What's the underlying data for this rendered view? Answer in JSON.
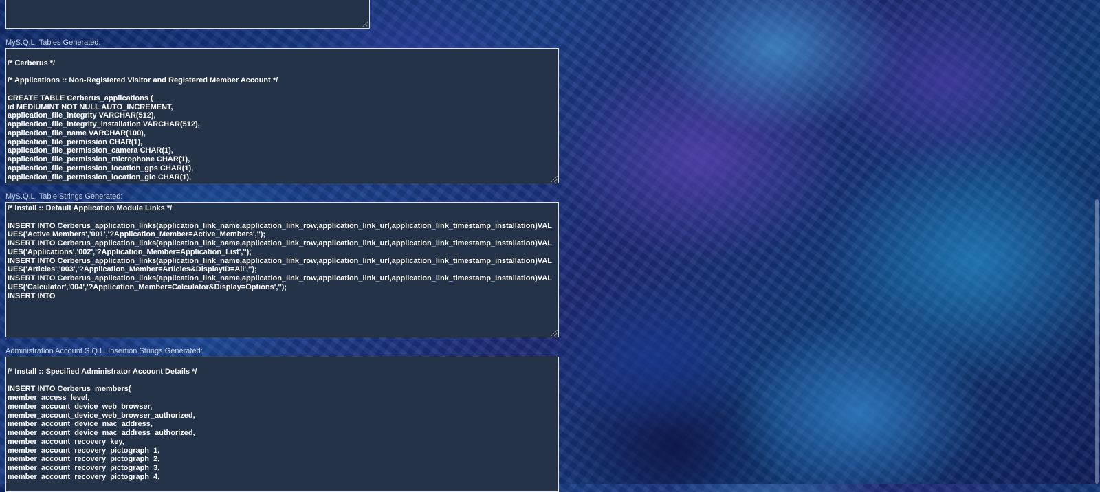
{
  "sections": [
    {
      "label": "",
      "content": ""
    },
    {
      "label": "MyS.Q.L. Tables Generated:",
      "content": "\n/* Cerberus */\n\n/* Applications :: Non-Registered Visitor and Registered Member Account */\n\nCREATE TABLE Cerberus_applications (\nid MEDIUMINT NOT NULL AUTO_INCREMENT,\napplication_file_integrity VARCHAR(512),\napplication_file_integrity_installation VARCHAR(512),\napplication_file_name VARCHAR(100),\napplication_file_permission CHAR(1),\napplication_file_permission_camera CHAR(1),\napplication_file_permission_microphone CHAR(1),\napplication_file_permission_location_gps CHAR(1),\napplication_file_permission_location_glo CHAR(1),"
    },
    {
      "label": "MyS.Q.L. Table Strings Generated:",
      "content": "/* Install :: Default Application Module Links */\n\nINSERT INTO Cerberus_application_links(application_link_name,application_link_row,application_link_url,application_link_timestamp_installation)VALUES('Active Members','001','?Application_Member=Active_Members','');\nINSERT INTO Cerberus_application_links(application_link_name,application_link_row,application_link_url,application_link_timestamp_installation)VALUES('Applications','002','?Application_Member=Application_List','');\nINSERT INTO Cerberus_application_links(application_link_name,application_link_row,application_link_url,application_link_timestamp_installation)VALUES('Articles','003','?Application_Member=Articles&DisplayID=All','');\nINSERT INTO Cerberus_application_links(application_link_name,application_link_row,application_link_url,application_link_timestamp_installation)VALUES('Calculator','004','?Application_Member=Calculator&Display=Options','');\nINSERT INTO"
    },
    {
      "label": "Administration Account S.Q.L. Insertion Strings Generated:",
      "content": "\n/* Install :: Specified Administrator Account Details */\n\nINSERT INTO Cerberus_members(\nmember_access_level,\nmember_account_device_web_browser,\nmember_account_device_web_browser_authorized,\nmember_account_device_mac_address,\nmember_account_device_mac_address_authorized,\nmember_account_recovery_key,\nmember_account_recovery_pictograph_1,\nmember_account_recovery_pictograph_2,\nmember_account_recovery_pictograph_3,\nmember_account_recovery_pictograph_4,"
    }
  ]
}
